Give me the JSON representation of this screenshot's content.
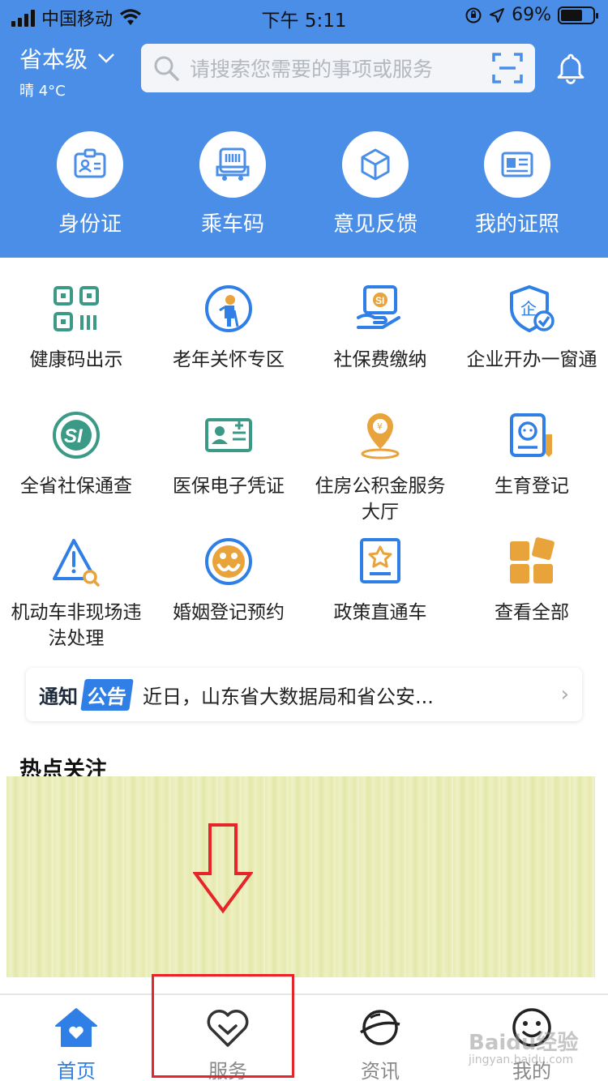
{
  "status_bar": {
    "carrier": "中国移动",
    "time": "下午 5:11",
    "battery": "69%",
    "battery_level": 0.69
  },
  "header": {
    "location": "省本级",
    "weather": "晴 4°C",
    "search_placeholder": "请搜索您需要的事项或服务"
  },
  "quick_actions": [
    {
      "label": "身份证",
      "icon": "id-card-icon"
    },
    {
      "label": "乘车码",
      "icon": "bus-code-icon"
    },
    {
      "label": "意见反馈",
      "icon": "feedback-box-icon"
    },
    {
      "label": "我的证照",
      "icon": "license-icon"
    }
  ],
  "services": [
    {
      "label": "健康码出示",
      "icon": "qr-code-icon"
    },
    {
      "label": "老年关怀专区",
      "icon": "elderly-care-icon"
    },
    {
      "label": "社保费缴纳",
      "icon": "social-security-pay-icon"
    },
    {
      "label": "企业开办一窗通",
      "icon": "enterprise-shield-icon"
    },
    {
      "label": "全省社保通查",
      "icon": "social-security-logo-icon"
    },
    {
      "label": "医保电子凭证",
      "icon": "medical-card-icon"
    },
    {
      "label": "住房公积金服务大厅",
      "icon": "housing-fund-pin-icon"
    },
    {
      "label": "生育登记",
      "icon": "birth-register-icon"
    },
    {
      "label": "机动车非现场违法处理",
      "icon": "traffic-warning-icon"
    },
    {
      "label": "婚姻登记预约",
      "icon": "marriage-icon"
    },
    {
      "label": "政策直通车",
      "icon": "policy-book-icon"
    },
    {
      "label": "查看全部",
      "icon": "grid-all-icon"
    }
  ],
  "notice": {
    "tag1": "通知",
    "tag2": "公告",
    "text": "近日，山东省大数据局和省公安..."
  },
  "hot": {
    "title": "热点关注"
  },
  "tabs": [
    {
      "label": "首页",
      "icon": "home-icon",
      "active": true
    },
    {
      "label": "服务",
      "icon": "heart-icon",
      "active": false
    },
    {
      "label": "资讯",
      "icon": "planet-icon",
      "active": false
    },
    {
      "label": "我的",
      "icon": "smile-face-icon",
      "active": false
    }
  ],
  "watermark": {
    "text": "Baidu经验",
    "sub": "jingyan.baidu.com"
  },
  "colors": {
    "header_blue": "#4a8ee8",
    "accent_blue": "#2f7fe6",
    "teal": "#3a9a86",
    "orange": "#e8a33a",
    "annotation_red": "#e5252a"
  }
}
